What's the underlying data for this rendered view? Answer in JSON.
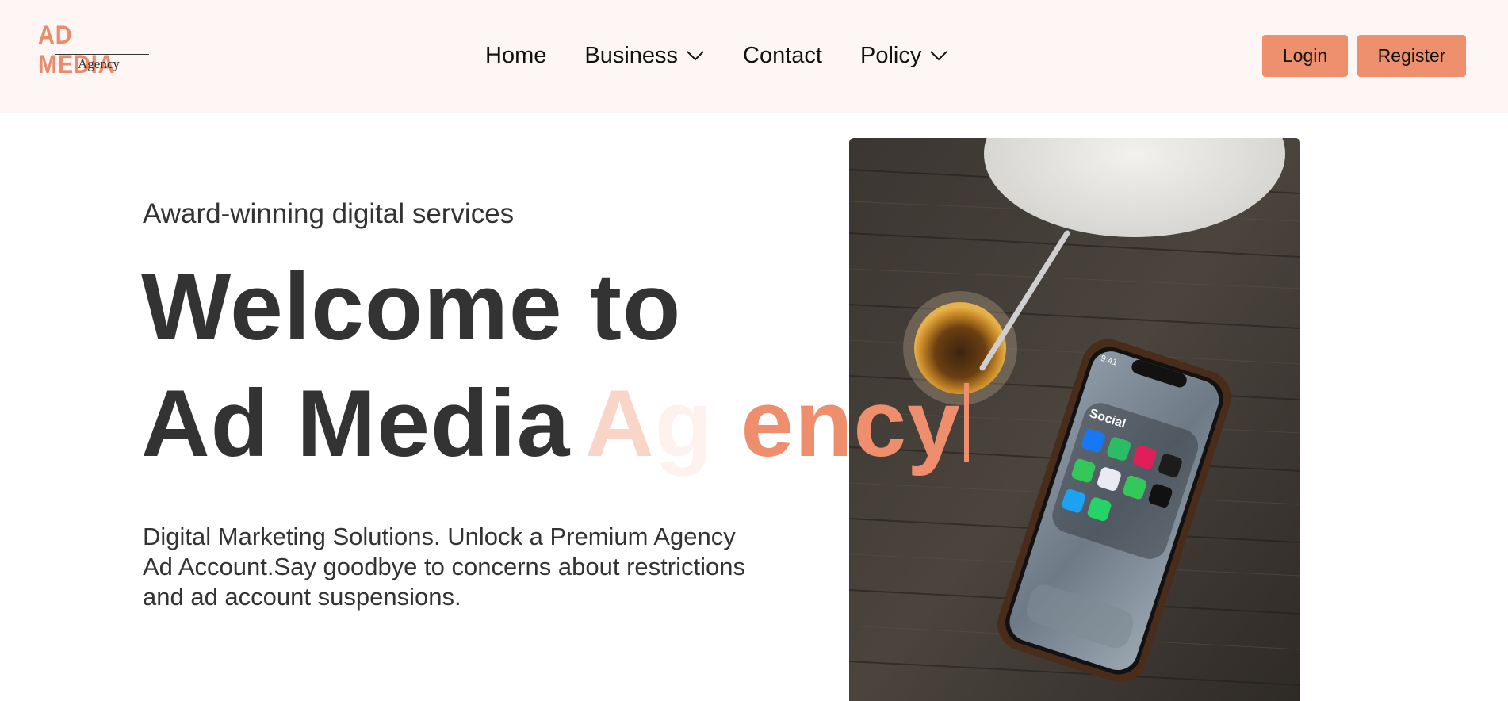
{
  "brand": {
    "logo_main": "AD MEDIA",
    "logo_sub": "Agency"
  },
  "nav": {
    "items": [
      {
        "label": "Home",
        "has_dropdown": false
      },
      {
        "label": "Business",
        "has_dropdown": true
      },
      {
        "label": "Contact",
        "has_dropdown": false
      },
      {
        "label": "Policy",
        "has_dropdown": true
      }
    ]
  },
  "auth": {
    "login_label": "Login",
    "register_label": "Register"
  },
  "hero": {
    "eyebrow": "Award-winning digital services",
    "title_line1": "Welcome to",
    "title_line2": "Ad Media",
    "typed_ghost1": "A",
    "typed_ghost2": "g",
    "typed_solid": " ency",
    "description": "Digital Marketing Solutions. Unlock a Premium Agency Ad Account.Say goodbye to concerns about restrictions and ad account suspensions."
  },
  "phone": {
    "folder_label": "Social",
    "time": "9:41"
  },
  "colors": {
    "accent": "#ee906d",
    "header_bg": "#fdf6f5",
    "text_dark": "#333333"
  }
}
